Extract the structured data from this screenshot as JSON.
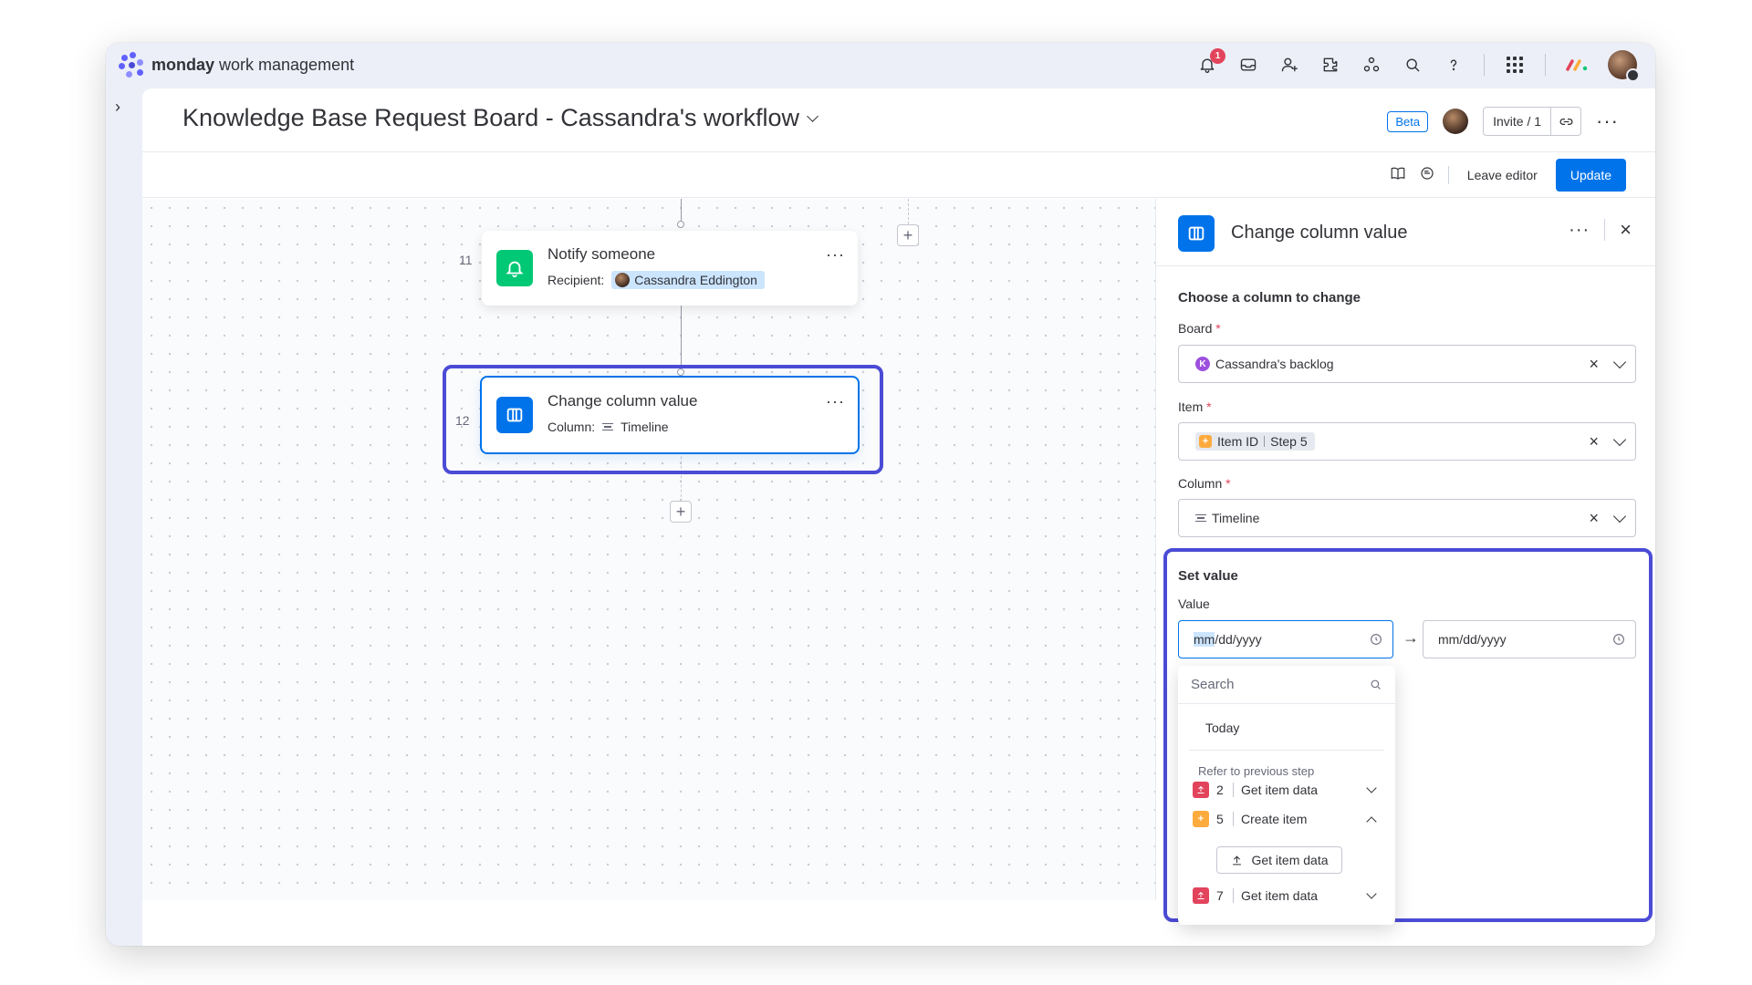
{
  "app": {
    "brand_bold": "monday",
    "brand_rest": " work management",
    "notification_count": "1"
  },
  "board": {
    "title": "Knowledge Base Request Board - Cassandra's workflow",
    "beta": "Beta",
    "invite": "Invite / 1"
  },
  "toolbar": {
    "leave": "Leave editor",
    "update": "Update"
  },
  "workflow": {
    "steps": [
      {
        "num": "11",
        "title": "Notify someone",
        "sub_label": "Recipient:",
        "sub_value": "Cassandra Eddington",
        "icon": "bell-icon",
        "color": "#00c875"
      },
      {
        "num": "12",
        "title": "Change column value",
        "sub_label": "Column:",
        "sub_value": "Timeline",
        "icon": "column-icon",
        "color": "#0073ea"
      }
    ]
  },
  "panel": {
    "title": "Change column value",
    "section1": "Choose a column to change",
    "board_label": "Board",
    "board_value": "Cassandra's backlog",
    "board_badge": "K",
    "item_label": "Item",
    "item_value_a": "Item ID",
    "item_value_b": "Step 5",
    "column_label": "Column",
    "column_value": "Timeline",
    "required": "*",
    "set_value": "Set value",
    "value_label": "Value",
    "date_start_prefix": "mm",
    "date_start_rest": "/dd/yyyy",
    "date_end": "mm/dd/yyyy"
  },
  "dropdown": {
    "search_placeholder": "Search",
    "today": "Today",
    "group": "Refer to previous step",
    "rows": [
      {
        "num": "2",
        "label": "Get item data",
        "color": "#e2445c"
      },
      {
        "num": "5",
        "label": "Create item",
        "color": "#fdab3d"
      },
      {
        "num": "7",
        "label": "Get item data",
        "color": "#e2445c"
      }
    ],
    "sub_button": "Get item data"
  },
  "colors": {
    "accent": "#0073ea",
    "highlight": "#4b4bd6"
  }
}
